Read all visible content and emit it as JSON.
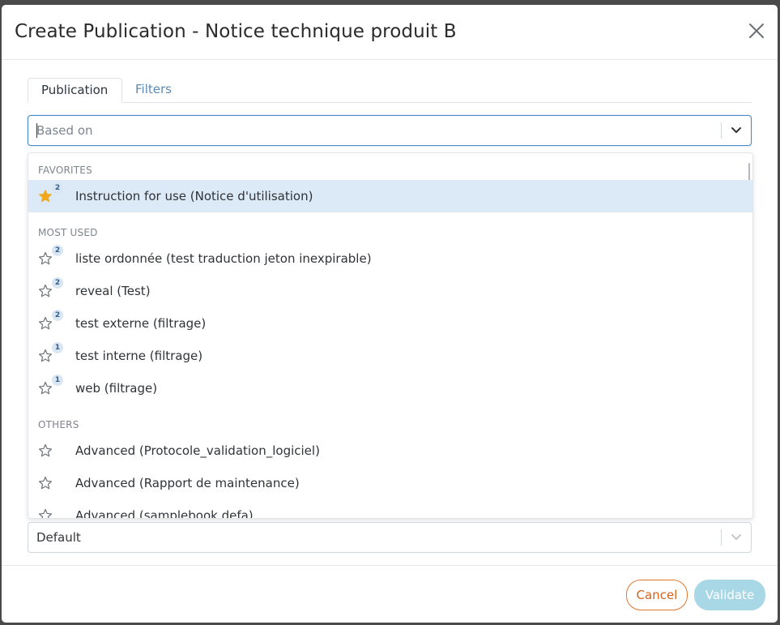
{
  "modal": {
    "title": "Create Publication - Notice technique produit B"
  },
  "tabs": [
    {
      "label": "Publication",
      "active": true
    },
    {
      "label": "Filters",
      "active": false
    }
  ],
  "based_on_select": {
    "placeholder": "Based on",
    "value": ""
  },
  "dropdown": {
    "groups": [
      {
        "label": "FAVORITES",
        "options": [
          {
            "label": "Instruction for use (Notice d'utilisation)",
            "count": "2",
            "favorite": true,
            "selected": true
          }
        ]
      },
      {
        "label": "MOST USED",
        "options": [
          {
            "label": "liste ordonnée (test traduction jeton inexpirable)",
            "count": "2",
            "favorite": false
          },
          {
            "label": "reveal (Test)",
            "count": "2",
            "favorite": false
          },
          {
            "label": "test externe (filtrage)",
            "count": "2",
            "favorite": false
          },
          {
            "label": "test interne (filtrage)",
            "count": "1",
            "favorite": false
          },
          {
            "label": "web (filtrage)",
            "count": "1",
            "favorite": false
          }
        ]
      },
      {
        "label": "OTHERS",
        "options": [
          {
            "label": "Advanced (Protocole_validation_logiciel)",
            "favorite": false
          },
          {
            "label": "Advanced (Rapport de maintenance)",
            "favorite": false
          },
          {
            "label": "Advanced (samplebook defa)",
            "favorite": false
          }
        ]
      }
    ]
  },
  "second_select": {
    "value": "Default"
  },
  "footer": {
    "cancel_label": "Cancel",
    "validate_label": "Validate"
  },
  "colors": {
    "accent": "#4a8cc9",
    "selected_bg": "#dce9f7",
    "star_filled": "#f0a81e",
    "cancel": "#e0772f",
    "validate_disabled": "#a8d7e6"
  }
}
